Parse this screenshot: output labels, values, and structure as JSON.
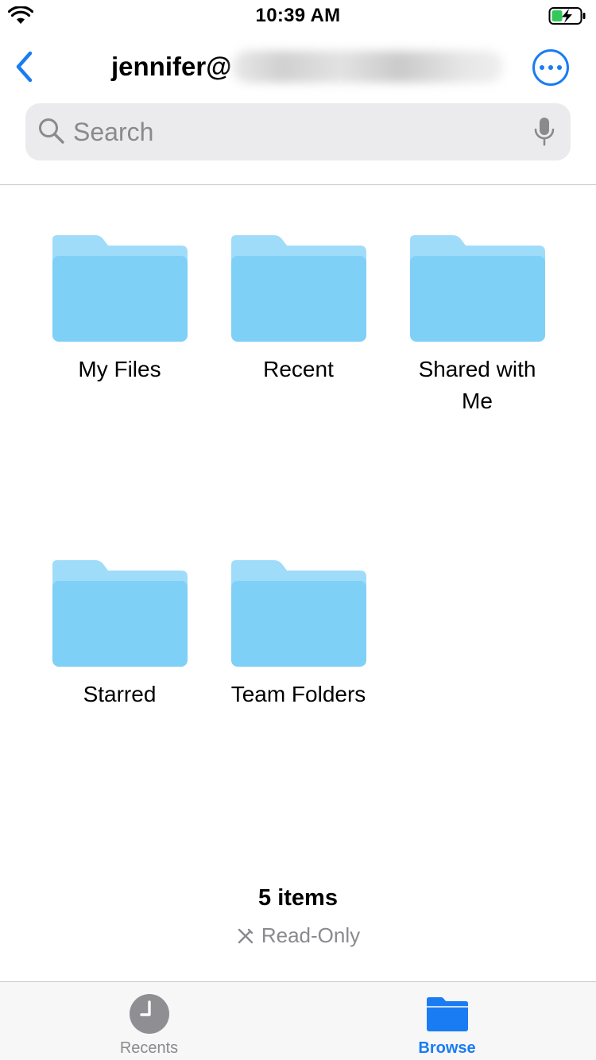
{
  "status_bar": {
    "time": "10:39 AM"
  },
  "nav": {
    "title": "jennifer@",
    "back_icon": "chevron-left-icon",
    "more_icon": "ellipsis-circle-icon"
  },
  "search": {
    "placeholder": "Search",
    "value": ""
  },
  "folders": [
    {
      "label": "My Files"
    },
    {
      "label": "Recent"
    },
    {
      "label": "Shared with Me"
    },
    {
      "label": "Starred"
    },
    {
      "label": "Team Folders"
    }
  ],
  "footer": {
    "count": "5 items",
    "readonly": "Read-Only"
  },
  "tabbar": {
    "recents": "Recents",
    "browse": "Browse",
    "active": "browse"
  },
  "colors": {
    "accent": "#1a7cf2",
    "folder": "#7fd0f7",
    "folder_tab": "#9fdcfa"
  }
}
